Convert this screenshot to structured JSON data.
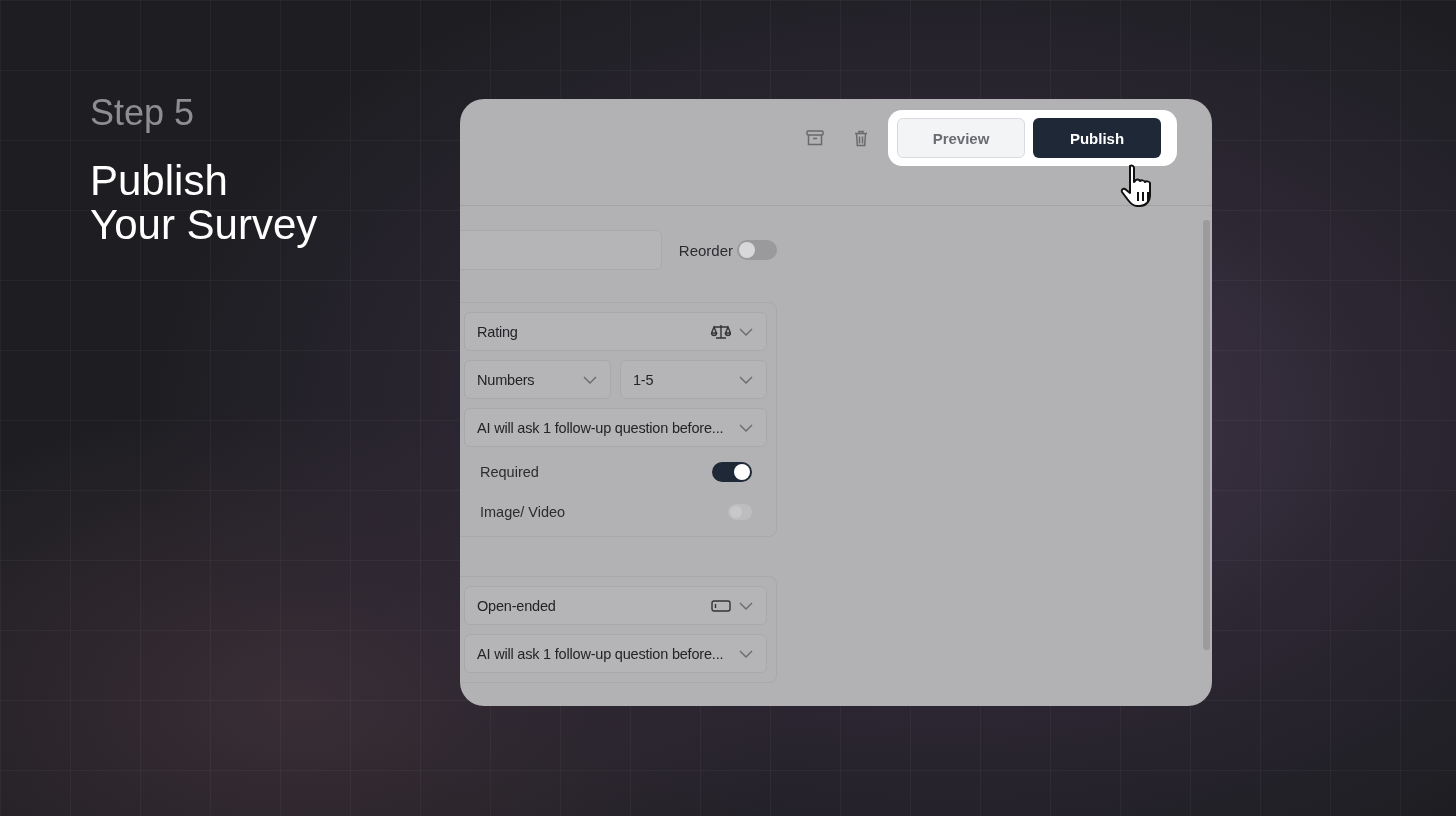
{
  "step_label": "Step 5",
  "headline_lines": [
    "Publish",
    "Your Survey"
  ],
  "app": {
    "toolbar_buttons": [
      {
        "label": "Preview",
        "kind": "secondary"
      },
      {
        "label": "Publish",
        "kind": "primary"
      }
    ],
    "reorder": {
      "label": "Reorder",
      "on": false
    },
    "question_cards": [
      {
        "kind": "rating",
        "select_rows": [
          [
            "Rating"
          ],
          [
            "Numbers",
            "1-5"
          ],
          [
            "AI will ask 1 follow-up question before..."
          ]
        ],
        "toggles": [
          {
            "label": "Required",
            "on": true,
            "disabled": false
          },
          {
            "label": "Image/ Video",
            "on": false,
            "disabled": true
          }
        ]
      },
      {
        "kind": "open-ended",
        "select_rows": [
          [
            "Open-ended"
          ],
          [
            "AI will ask 1 follow-up question before..."
          ]
        ]
      }
    ]
  }
}
